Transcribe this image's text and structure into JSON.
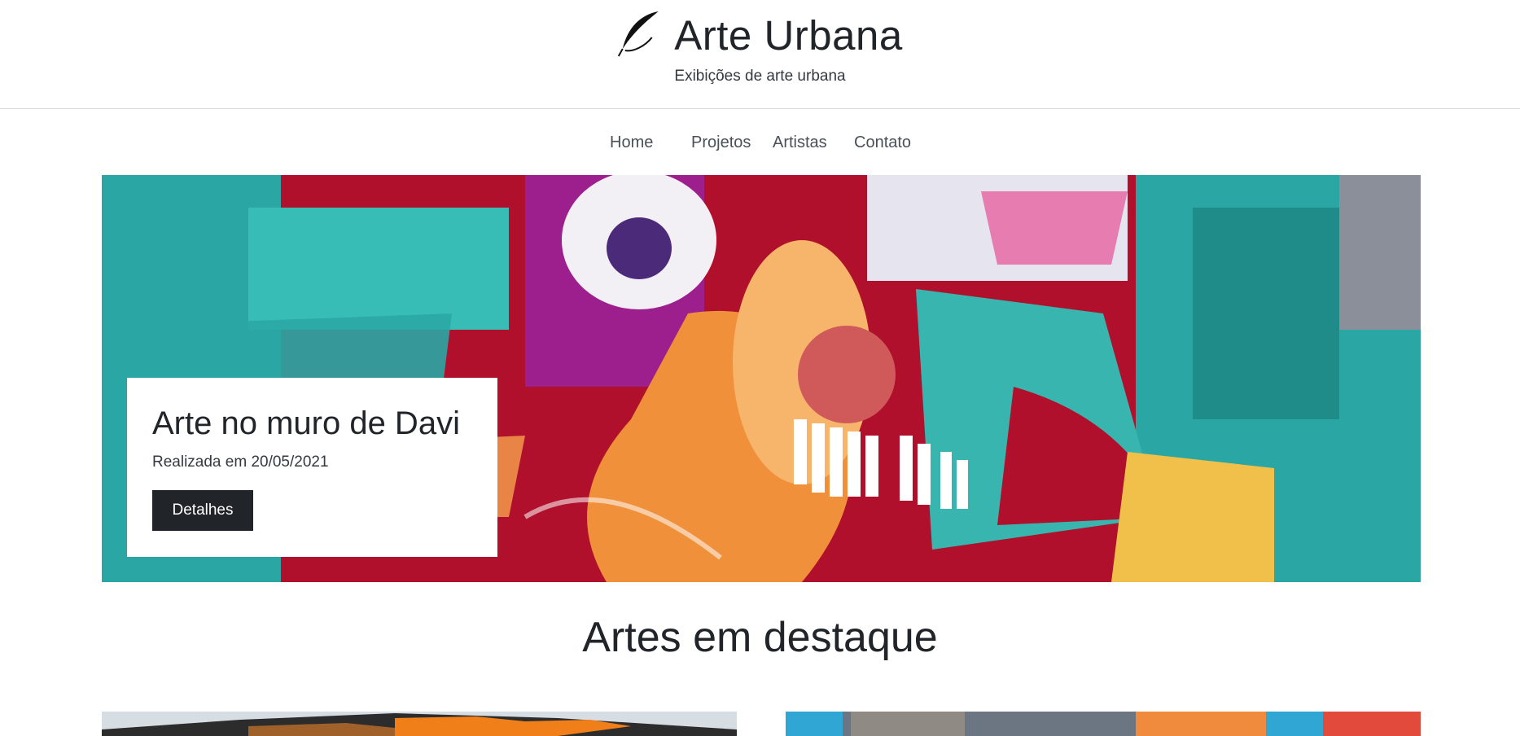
{
  "header": {
    "title": "Arte Urbana",
    "subtitle": "Exibições de arte urbana",
    "logo_icon": "feather-icon"
  },
  "nav": {
    "items": [
      {
        "label": "Home"
      },
      {
        "label": "Projetos"
      },
      {
        "label": "Artistas"
      },
      {
        "label": "Contato"
      }
    ]
  },
  "hero": {
    "title": "Arte no muro de Davi",
    "date": "Realizada em 20/05/2021",
    "button_label": "Detalhes",
    "image": "graffiti-mural-image"
  },
  "featured": {
    "title": "Artes em destaque",
    "cards": [
      {
        "image": "featured-art-image-1"
      },
      {
        "image": "featured-art-image-2"
      }
    ]
  },
  "colors": {
    "text": "#212529",
    "button_bg": "#212529",
    "button_text": "#ffffff",
    "border": "#d9d9d9",
    "mural_red": "#b0102b",
    "mural_teal": "#2aa7a5",
    "mural_orange": "#f0903a",
    "mural_pink": "#e67cb0"
  }
}
